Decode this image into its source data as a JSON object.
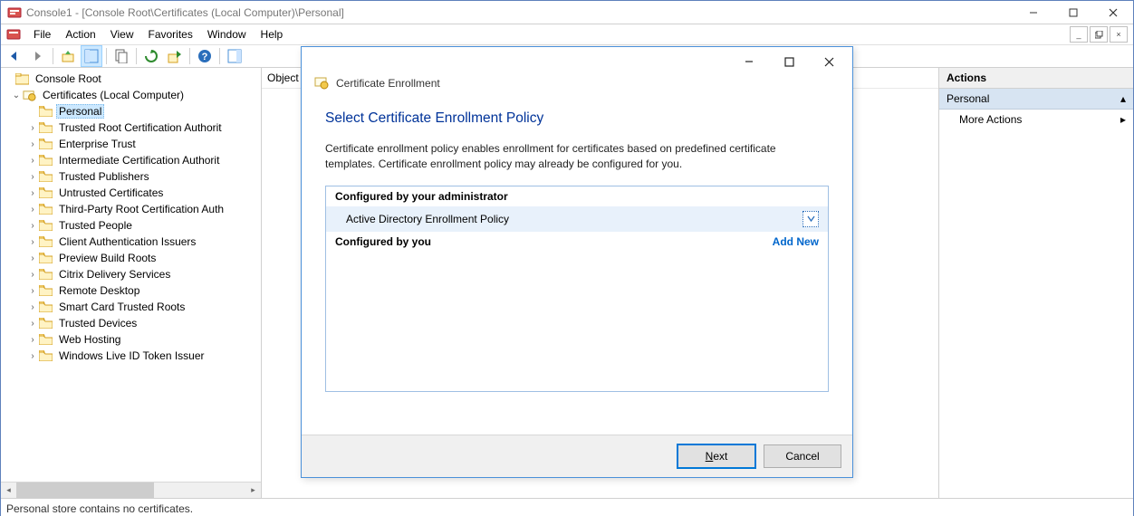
{
  "window": {
    "title": "Console1 - [Console Root\\Certificates (Local Computer)\\Personal]"
  },
  "menubar": [
    "File",
    "Action",
    "View",
    "Favorites",
    "Window",
    "Help"
  ],
  "tree": {
    "root": "Console Root",
    "snapin": "Certificates (Local Computer)",
    "selected": "Personal",
    "items": [
      "Personal",
      "Trusted Root Certification Authorit",
      "Enterprise Trust",
      "Intermediate Certification Authorit",
      "Trusted Publishers",
      "Untrusted Certificates",
      "Third-Party Root Certification Auth",
      "Trusted People",
      "Client Authentication Issuers",
      "Preview Build Roots",
      "Citrix Delivery Services",
      "Remote Desktop",
      "Smart Card Trusted Roots",
      "Trusted Devices",
      "Web Hosting",
      "Windows Live ID Token Issuer"
    ]
  },
  "center": {
    "column_header": "Object"
  },
  "actions": {
    "header": "Actions",
    "section": "Personal",
    "more": "More Actions"
  },
  "statusbar": "Personal store contains no certificates.",
  "dialog": {
    "breadcrumb": "Certificate Enrollment",
    "heading": "Select Certificate Enrollment Policy",
    "description": "Certificate enrollment policy enables enrollment for certificates based on predefined certificate templates. Certificate enrollment policy may already be configured for you.",
    "section_admin": "Configured by your administrator",
    "policy_item": "Active Directory Enrollment Policy",
    "section_you": "Configured by you",
    "add_new": "Add New",
    "next": "Next",
    "cancel": "Cancel"
  }
}
